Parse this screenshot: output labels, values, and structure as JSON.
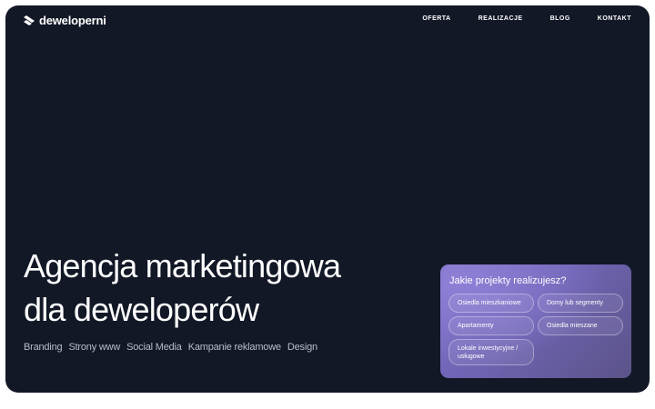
{
  "brand": {
    "name": "deweloperni"
  },
  "nav": {
    "items": [
      "OFERTA",
      "REALIZACJE",
      "BLOG",
      "KONTAKT"
    ]
  },
  "hero": {
    "headline_line1": "Agencja marketingowa",
    "headline_line2": "dla deweloperów",
    "services": [
      "Branding",
      "Strony www",
      "Social Media",
      "Kampanie reklamowe",
      "Design"
    ]
  },
  "project_card": {
    "title": "Jakie projekty realizujesz?",
    "options": [
      "Osiedla mieszkaniowe",
      "Domy lub segmenty",
      "Apartamenty",
      "Osiedla mieszane",
      "Lokale inwestycyjne / usługowe"
    ]
  },
  "colors": {
    "background": "#121826",
    "card_accent": "#7d71c9",
    "text": "#ffffff"
  }
}
